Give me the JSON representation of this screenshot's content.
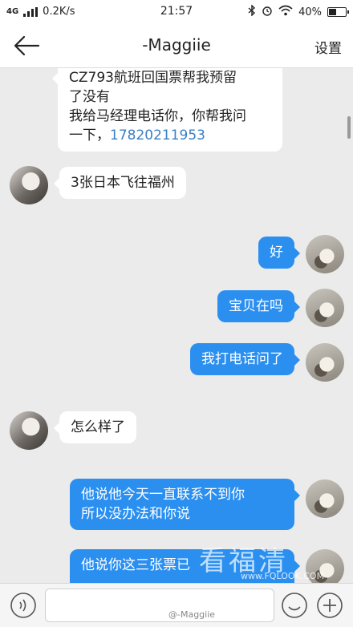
{
  "status_bar": {
    "network": "4G",
    "speed": "0.2K/s",
    "time": "21:57",
    "battery": "40%",
    "battery_level": 0.4
  },
  "header": {
    "title": "-Maggiie",
    "settings_label": "设置",
    "back_icon": "back-arrow-icon"
  },
  "messages": [
    {
      "side": "in",
      "lines": [
        "CZ793航班回国票帮我预留",
        "了没有",
        "我给马经理电话你，你帮我问",
        "一下，"
      ],
      "phone": "17820211953"
    },
    {
      "side": "in",
      "text": "3张日本飞往福州"
    },
    {
      "side": "out",
      "text": "好"
    },
    {
      "side": "out",
      "text": "宝贝在吗"
    },
    {
      "side": "out",
      "text": "我打电话问了"
    },
    {
      "side": "in",
      "text": "怎么样了"
    },
    {
      "side": "out",
      "lines": [
        "他说他今天一直联系不到你",
        "所以没办法和你说"
      ]
    },
    {
      "side": "out",
      "text": "他说你这三张票已"
    }
  ],
  "input_bar": {
    "placeholder": "",
    "voice_icon": "voice-icon",
    "emoji_icon": "emoji-icon",
    "plus_icon": "plus-icon"
  },
  "watermark": {
    "weibo": "@-Maggiie",
    "big": "看福清",
    "url": "www.FQLOOK.COM"
  },
  "colors": {
    "out_bubble": "#2b8ff0",
    "in_bubble": "#ffffff",
    "background": "#ebebeb",
    "link": "#3a7fc5"
  }
}
